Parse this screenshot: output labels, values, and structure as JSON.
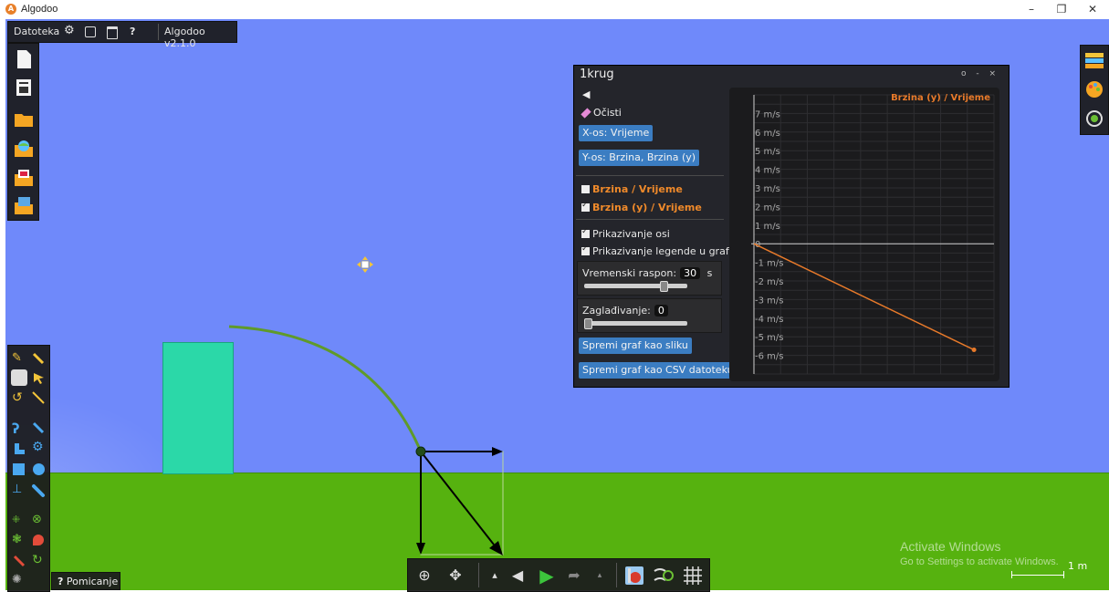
{
  "window": {
    "title": "Algodoo",
    "minimize": "–",
    "restore": "❐",
    "close": "✕"
  },
  "top_menu": {
    "file_label": "Datoteka",
    "version_label": "Algodoo v2.1.0",
    "icons": [
      "gear-icon",
      "play-settings-icon",
      "window-icon",
      "help-icon"
    ],
    "help_label": "?"
  },
  "file_toolbar": {
    "items": [
      "new-scene-icon",
      "scene-settings-icon",
      "open-folder-icon",
      "open-online-icon",
      "open-folder-photo-icon",
      "save-icon"
    ]
  },
  "tool_tooltip": {
    "help_label": "?",
    "text": "Pomicanje"
  },
  "right_toolbar": {
    "items": [
      "layers-icon",
      "palette-icon",
      "download-icon"
    ]
  },
  "bottom_toolbar": {
    "zoom": "⊕",
    "pan": "✥",
    "speed_up": "▴",
    "undo": "◀",
    "play": "▶",
    "redo": "➦",
    "speed_down": "▴"
  },
  "watermark": {
    "line1": "Activate Windows",
    "line2": "Go to Settings to activate Windows."
  },
  "scale_label": "1 m",
  "graph_window": {
    "title": "1krug",
    "controls": "o - ×",
    "back": "◀",
    "clear_label": "Očisti",
    "x_axis_button": "X-os: Vrijeme",
    "y_axis_button": "Y-os: Brzina, Brzina (y)",
    "series_toggles": [
      {
        "label": "Brzina / Vrijeme",
        "checked": false
      },
      {
        "label": "Brzina (y) / Vrijeme",
        "checked": true
      }
    ],
    "options": [
      {
        "label": "Prikazivanje osi",
        "checked": true
      },
      {
        "label": "Prikazivanje legende u grafu",
        "checked": true
      }
    ],
    "time_range": {
      "label": "Vremenski raspon:",
      "value": "30",
      "unit": "s",
      "level": 0.78
    },
    "smoothing": {
      "label": "Zaglađivanje:",
      "value": "0",
      "level": 0.0
    },
    "save_image_button": "Spremi graf kao sliku",
    "save_csv_button": "Spremi graf kao CSV datoteku"
  },
  "chart_data": {
    "type": "line",
    "legend": "Brzina (y) / Vrijeme",
    "legend_position": "top-right",
    "y_ticks": [
      "7 m/s",
      "6 m/s",
      "5 m/s",
      "4 m/s",
      "3 m/s",
      "2 m/s",
      "1 m/s",
      "0",
      "-1 m/s",
      "-2 m/s",
      "-3 m/s",
      "-4 m/s",
      "-5 m/s",
      "-6 m/s"
    ],
    "ylim": [
      -7,
      8
    ],
    "xlim": [
      0,
      1.8
    ],
    "grid": true,
    "series": [
      {
        "name": "Brzina (y) / Vrijeme",
        "color": "#e87a2a",
        "points": [
          [
            0,
            0
          ],
          [
            1.65,
            -5.7
          ]
        ]
      }
    ]
  },
  "colors": {
    "sky": "#6f89fa",
    "ground": "#56b20f",
    "box": "#2bd8a8",
    "trajectory": "#5f9a2a",
    "button_blue": "#3b7dc2",
    "series_orange": "#e87a2a"
  }
}
